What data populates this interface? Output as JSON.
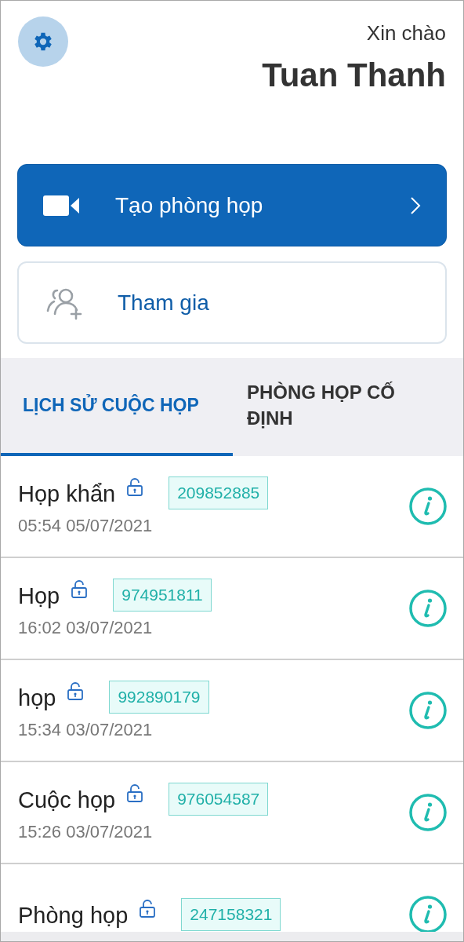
{
  "header": {
    "greeting": "Xin chào",
    "user_name": "Tuan Thanh"
  },
  "actions": [
    {
      "kind": "primary",
      "label": "Tạo phòng họp"
    },
    {
      "kind": "secondary",
      "label": "Tham gia"
    }
  ],
  "tabs": [
    {
      "label": "LỊCH SỬ CUỘC HỌP",
      "selected": true
    },
    {
      "label": "PHÒNG HỌP CỐ ĐỊNH",
      "selected": false
    }
  ],
  "meetings": [
    {
      "name": "Họp khẩn",
      "code": "209852885",
      "time": "05:54 05/07/2021"
    },
    {
      "name": "Họp",
      "code": "974951811",
      "time": "16:02 03/07/2021"
    },
    {
      "name": "họp",
      "code": "992890179",
      "time": "15:34 03/07/2021"
    },
    {
      "name": "Cuộc họp",
      "code": "976054587",
      "time": "15:26 03/07/2021"
    },
    {
      "name": "Phòng họp",
      "code": "247158321"
    }
  ]
}
